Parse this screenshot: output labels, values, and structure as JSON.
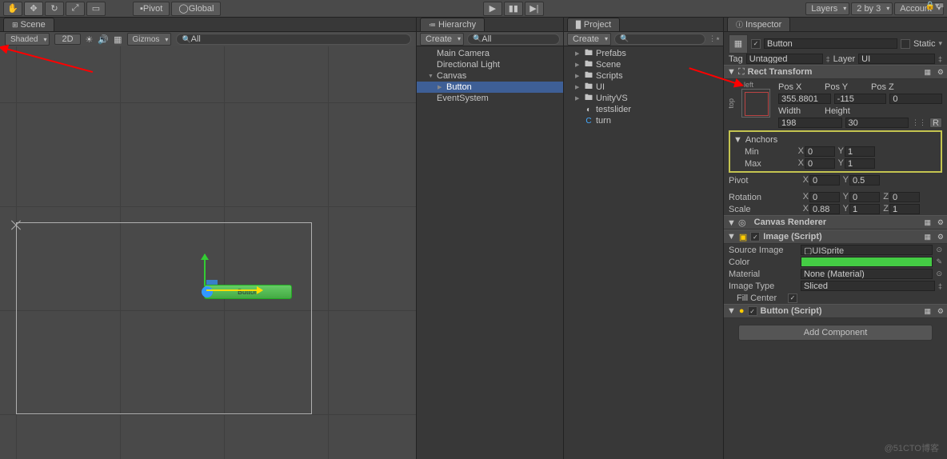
{
  "toolbar": {
    "pivot": "Pivot",
    "global": "Global",
    "layers": "Layers",
    "layout": "2 by 3",
    "account": "Account"
  },
  "scene": {
    "tab": "Scene",
    "shaded": "Shaded",
    "twod": "2D",
    "gizmos": "Gizmos",
    "search_ph": "All",
    "button_label": "Button"
  },
  "hierarchy": {
    "tab": "Hierarchy",
    "create": "Create",
    "search_ph": "All",
    "items": [
      "Main Camera",
      "Directional Light",
      "Canvas",
      "Button",
      "EventSystem"
    ]
  },
  "project": {
    "tab": "Project",
    "create": "Create",
    "items": [
      "Prefabs",
      "Scene",
      "Scripts",
      "UI",
      "UnityVS",
      "testslider",
      "turn"
    ]
  },
  "inspector": {
    "tab": "Inspector",
    "name": "Button",
    "static": "Static",
    "tag_lbl": "Tag",
    "tag": "Untagged",
    "layer_lbl": "Layer",
    "layer": "UI",
    "rect": {
      "title": "Rect Transform",
      "left": "left",
      "top": "top",
      "posx_l": "Pos X",
      "posy_l": "Pos Y",
      "posz_l": "Pos Z",
      "posx": "355.8801",
      "posy": "-115",
      "posz": "0",
      "w_l": "Width",
      "h_l": "Height",
      "w": "198",
      "h": "30",
      "r": "R",
      "anchors": "Anchors",
      "min": "Min",
      "max": "Max",
      "min_x": "0",
      "min_y": "1",
      "max_x": "0",
      "max_y": "1",
      "pivot": "Pivot",
      "piv_x": "0",
      "piv_y": "0.5",
      "rot": "Rotation",
      "rot_x": "0",
      "rot_y": "0",
      "rot_z": "0",
      "scale": "Scale",
      "sc_x": "0.88",
      "sc_y": "1",
      "sc_z": "1"
    },
    "cr": "Canvas Renderer",
    "img": {
      "title": "Image (Script)",
      "src_l": "Source Image",
      "src": "UISprite",
      "color_l": "Color",
      "mat_l": "Material",
      "mat": "None (Material)",
      "type_l": "Image Type",
      "type": "Sliced",
      "fill_l": "Fill Center"
    },
    "btn": "Button (Script)",
    "add": "Add Component"
  },
  "watermark": "@51CTO博客"
}
